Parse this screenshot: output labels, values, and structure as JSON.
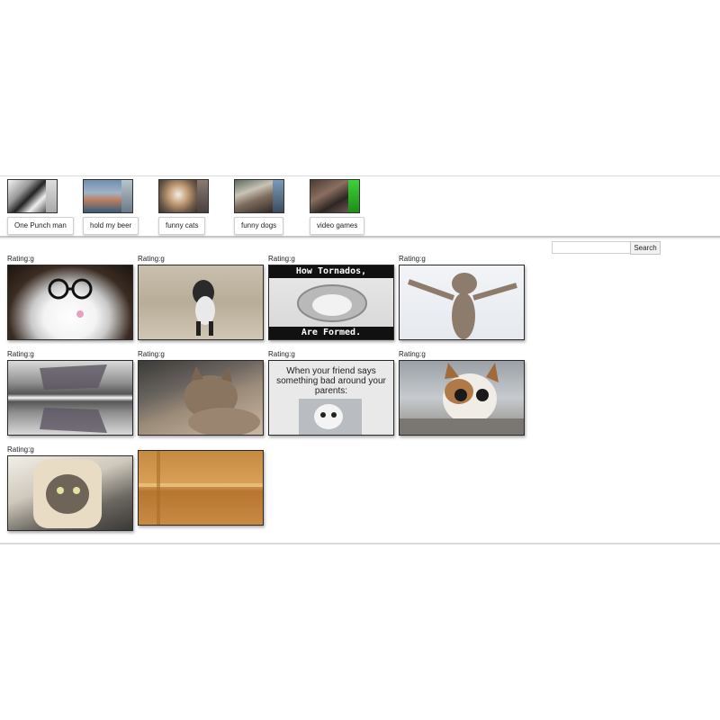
{
  "topics": [
    {
      "label": "One Punch man"
    },
    {
      "label": "hold my beer"
    },
    {
      "label": "funny cats"
    },
    {
      "label": "funny dogs"
    },
    {
      "label": "video games"
    }
  ],
  "search": {
    "button_label": "Search",
    "value": ""
  },
  "gifs": [
    {
      "rating": "Rating:g",
      "subject": "cat wearing glasses"
    },
    {
      "rating": "Rating:g",
      "subject": "cat standing on hind legs"
    },
    {
      "rating": "Rating:g",
      "subject": "tornado meme",
      "caption_top": "How Tornados,",
      "caption_bottom": "Are Formed."
    },
    {
      "rating": "Rating:g",
      "subject": "cat stretching arms"
    },
    {
      "rating": "Rating:g",
      "subject": "distorted glitch"
    },
    {
      "rating": "Rating:g",
      "subject": "sleepy cat"
    },
    {
      "rating": "Rating:g",
      "subject": "cat meme",
      "meme_text": "When your friend says something bad around your parents:"
    },
    {
      "rating": "Rating:g",
      "subject": "wide-eyed kitten"
    },
    {
      "rating": "Rating:g",
      "subject": "cat in bread slice"
    },
    {
      "rating": "",
      "subject": "orange room"
    }
  ]
}
